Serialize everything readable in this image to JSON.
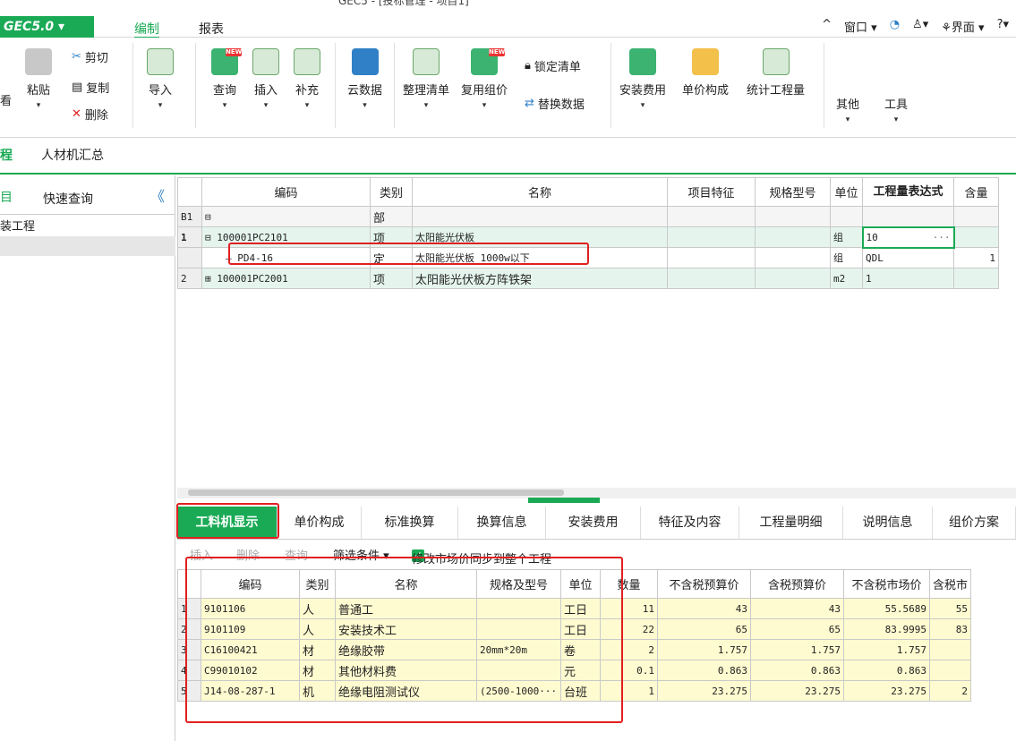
{
  "window": {
    "title": "GEC5 - [投标管理 - 项目1]"
  },
  "menu": {
    "app": "GEC5.0 ▾",
    "tab_edit": "编制",
    "tab_report": "报表",
    "right": {
      "caret": "^",
      "window": "窗口 ▾",
      "user": "▾",
      "view": "界面 ▾",
      "help": "▾"
    }
  },
  "ribbon": {
    "view_cut": "看",
    "paste": "粘贴",
    "cut": "剪切",
    "copy": "复制",
    "delete": "删除",
    "import": "导入",
    "query": "查询",
    "insert": "插入",
    "supplement": "补充",
    "cloud": "云数据",
    "organize": "整理清单",
    "reuse": "复用组价",
    "lock": "锁定清单",
    "replace": "替换数据",
    "install_fee": "安装费用",
    "unit_price": "单价构成",
    "stat": "统计工程量",
    "other": "其他",
    "tools": "工具",
    "new_badge": "NEW",
    "arrow": "▾"
  },
  "tabs2": {
    "t1": "程",
    "t2": "人材机汇总"
  },
  "left": {
    "tab_a": "目",
    "tab_b": "快速查询",
    "collapse": "《",
    "item": "装工程"
  },
  "upper": {
    "headers": [
      "",
      "编码",
      "类别",
      "名称",
      "项目特征",
      "规格型号",
      "单位",
      "工程量表达式",
      "含量"
    ],
    "rows": [
      {
        "no": "B1",
        "tree": "⊟",
        "code": "",
        "type": "部",
        "name": "",
        "feat": "",
        "spec": "",
        "unit": "",
        "expr": "",
        "qty": ""
      },
      {
        "no": "1",
        "tree": "⊟",
        "code": "100001PC2101",
        "type": "项",
        "name": "太阳能光伏板",
        "feat": "",
        "spec": "",
        "unit": "组",
        "expr": "10",
        "qty": "",
        "dots": "···"
      },
      {
        "no": "",
        "tree": "—",
        "code": "PD4-16",
        "type": "定",
        "name": "太阳能光伏板 1000w以下",
        "feat": "",
        "spec": "",
        "unit": "组",
        "expr": "QDL",
        "qty": "1"
      },
      {
        "no": "2",
        "tree": "⊞",
        "code": "100001PC2001",
        "type": "项",
        "name": "太阳能光伏板方阵铁架",
        "feat": "",
        "spec": "",
        "unit": "m2",
        "expr": "1",
        "qty": ""
      }
    ]
  },
  "btabs": [
    "工料机显示",
    "单价构成",
    "标准换算",
    "换算信息",
    "安装费用",
    "特征及内容",
    "工程量明细",
    "说明信息",
    "组价方案"
  ],
  "btool": {
    "insert": "插入",
    "delete": "删除",
    "query": "查询",
    "filter": "筛选条件 ▾",
    "sync": "修改市场价同步到整个工程",
    "check": "✓"
  },
  "lower": {
    "headers": [
      "",
      "编码",
      "类别",
      "名称",
      "规格及型号",
      "单位",
      "数量",
      "不含税预算价",
      "含税预算价",
      "不含税市场价",
      "含税市"
    ],
    "rows": [
      {
        "no": "1",
        "code": "9101106",
        "type": "人",
        "name": "普通工",
        "spec": "",
        "unit": "工日",
        "qty": "11",
        "p1": "43",
        "p2": "43",
        "p3": "55.5689",
        "p4": "55"
      },
      {
        "no": "2",
        "code": "9101109",
        "type": "人",
        "name": "安装技术工",
        "spec": "",
        "unit": "工日",
        "qty": "22",
        "p1": "65",
        "p2": "65",
        "p3": "83.9995",
        "p4": "83"
      },
      {
        "no": "3",
        "code": "C16100421",
        "type": "材",
        "name": "绝缘胶带",
        "spec": "20mm*20m",
        "unit": "卷",
        "qty": "2",
        "p1": "1.757",
        "p2": "1.757",
        "p3": "1.757",
        "p4": ""
      },
      {
        "no": "4",
        "code": "C99010102",
        "type": "材",
        "name": "其他材料费",
        "spec": "",
        "unit": "元",
        "qty": "0.1",
        "p1": "0.863",
        "p2": "0.863",
        "p3": "0.863",
        "p4": ""
      },
      {
        "no": "5",
        "code": "J14-08-287-1",
        "type": "机",
        "name": "绝缘电阻测试仪",
        "spec": "(2500-1000···",
        "unit": "台班",
        "qty": "1",
        "p1": "23.275",
        "p2": "23.275",
        "p3": "23.275",
        "p4": "2"
      }
    ]
  }
}
